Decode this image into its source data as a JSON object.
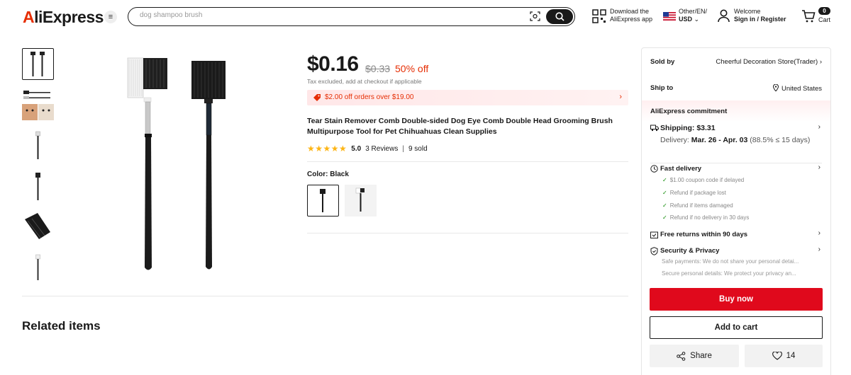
{
  "header": {
    "logo": "AliExpress",
    "search_placeholder": "dog shampoo brush",
    "app_line1": "Download the",
    "app_line2": "AliExpress app",
    "region_line1": "Other/EN/",
    "region_line2": "USD",
    "account_line1": "Welcome",
    "account_line2": "Sign in / Register",
    "cart_count": "0",
    "cart_label": "Cart"
  },
  "product": {
    "price": "$0.16",
    "old_price": "$0.33",
    "discount": "50% off",
    "tax_note": "Tax excluded, add at checkout if applicable",
    "coupon": "$2.00 off orders over $19.00",
    "title": "Tear Stain Remover Comb Double-sided Dog Eye Comb Double Head Grooming Brush Multipurpose Tool for Pet Chihuahuas Clean Supplies",
    "stars": "★★★★★",
    "rating": "5.0",
    "reviews": "3 Reviews",
    "sep": "|",
    "sold": "9 sold",
    "color_label": "Color: Black"
  },
  "related_title": "Related items",
  "panel": {
    "sold_by_label": "Sold by",
    "sold_by_value": "Cheerful Decoration Store(Trader)",
    "ship_to_label": "Ship to",
    "ship_to_value": "United States",
    "commitment": "AliExpress commitment",
    "shipping": "Shipping: $3.31",
    "delivery_prefix": "Delivery: ",
    "delivery_dates": "Mar. 26 - Apr. 03",
    "delivery_suffix": " (88.5% ≤ 15 days)",
    "fast_delivery": "Fast delivery",
    "fast_items": [
      "$1.00 coupon code if delayed",
      "Refund if package lost",
      "Refund if items damaged",
      "Refund if no delivery in 30 days"
    ],
    "free_returns": "Free returns within 90 days",
    "security": "Security & Privacy",
    "security_lines": [
      "Safe payments: We do not share your personal detai...",
      "Secure personal details: We protect your privacy an..."
    ],
    "buy_now": "Buy now",
    "add_to_cart": "Add to cart",
    "share": "Share",
    "wishlist_count": "14"
  },
  "colors": {
    "accent": "#e0091c",
    "brand": "#e62e04",
    "star": "#fdb515"
  }
}
